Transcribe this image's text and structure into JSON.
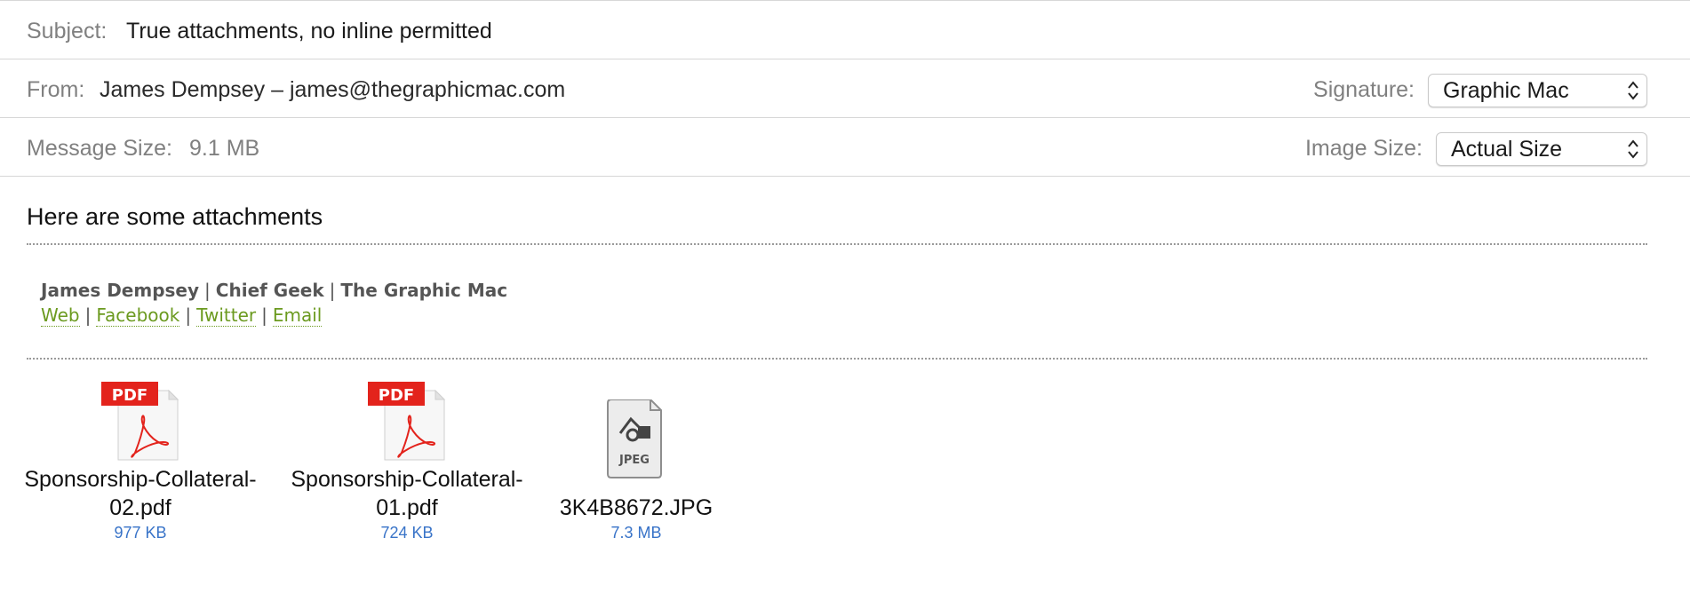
{
  "header": {
    "subject_label": "Subject:",
    "subject_value": "True attachments, no inline permitted",
    "from_label": "From:",
    "from_value": "James Dempsey – james@thegraphicmac.com",
    "signature_label": "Signature:",
    "signature_value": "Graphic Mac",
    "message_size_label": "Message Size:",
    "message_size_value": "9.1 MB",
    "image_size_label": "Image Size:",
    "image_size_value": "Actual Size"
  },
  "body": {
    "text": "Here are some attachments"
  },
  "signature": {
    "name": "James Dempsey",
    "title": "Chief Geek",
    "company": "The Graphic Mac",
    "separator": "|",
    "links": [
      "Web",
      "Facebook",
      "Twitter",
      "Email"
    ],
    "link_color": "#6b9a1f"
  },
  "attachments": [
    {
      "name_line1": "Sponsorship-Collateral-",
      "name_line2": "02.pdf",
      "size": "977 KB",
      "icon": "pdf-document-icon",
      "badge": "PDF"
    },
    {
      "name_line1": "Sponsorship-Collateral-",
      "name_line2": "01.pdf",
      "size": "724 KB",
      "icon": "pdf-document-icon",
      "badge": "PDF"
    },
    {
      "name_line1": "",
      "name_line2": "3K4B8672.JPG",
      "size": "7.3 MB",
      "icon": "jpeg-document-icon",
      "badge": "JPEG"
    }
  ],
  "colors": {
    "accent_link": "#6b9a1f",
    "file_size": "#3873c8",
    "pdf_badge": "#e3231c"
  }
}
